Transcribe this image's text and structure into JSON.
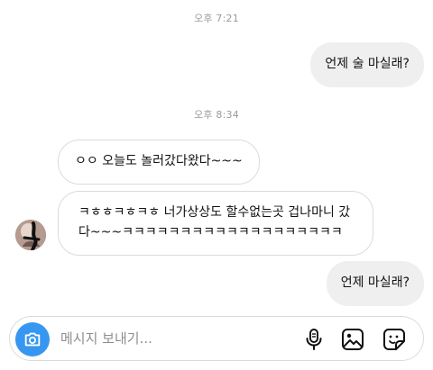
{
  "timestamps": [
    "오후 7:21",
    "오후 8:34"
  ],
  "messages": {
    "sent_1": "언제 술 마실래?",
    "received_1": "ㅇㅇ 오늘도 놀러갔다왔다~~~",
    "received_2": "ㅋㅎㅎㅋㅎㅋㅎ 너가상상도 할수없는곳 겁나마니 갔다~~~ㅋㅋㅋㅋㅋㅋㅋㅋㅋㅋㅋㅋㅋㅋㅋㅋㅋㅋㅋ",
    "sent_2": "언제 마실래?"
  },
  "composer": {
    "placeholder": "메시지 보내기...",
    "value": "",
    "icons": [
      "camera-icon",
      "microphone-icon",
      "gallery-icon",
      "sticker-icon"
    ]
  },
  "colors": {
    "accent": "#3797f0",
    "sent_bubble": "#efefef",
    "received_border": "#dbdbdb",
    "timestamp": "#9a9a9a"
  }
}
